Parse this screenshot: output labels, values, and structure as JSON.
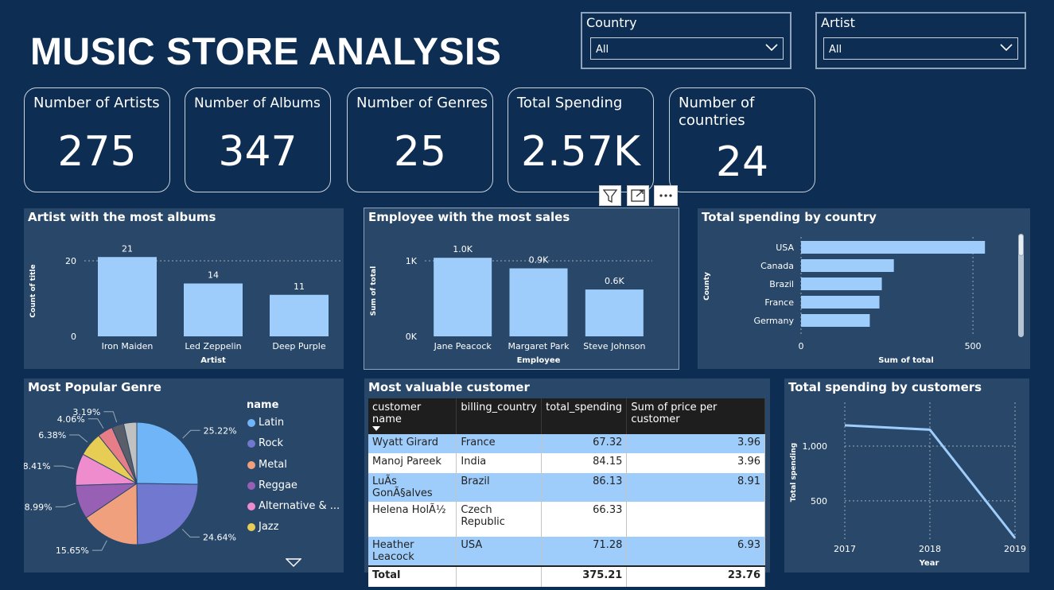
{
  "header": {
    "title": "MUSIC STORE ANALYSIS"
  },
  "slicers": [
    {
      "label": "Country",
      "value": "All"
    },
    {
      "label": "Artist",
      "value": "All"
    }
  ],
  "cards": [
    {
      "label": "Number of Artists",
      "value": "275"
    },
    {
      "label": "Number of Albums",
      "value": "347"
    },
    {
      "label": "Number of Genres",
      "value": "25"
    },
    {
      "label": "Total Spending",
      "value": "2.57K"
    },
    {
      "label_line1": "Number of",
      "label_line2": "countries",
      "value": "24"
    }
  ],
  "visual_header_icons": [
    "filter-icon",
    "focus-mode-icon",
    "more-options-icon"
  ],
  "artist_chart": {
    "title": "Artist with the most albums",
    "chart_data": {
      "type": "bar",
      "categories": [
        "Iron Maiden",
        "Led Zeppelin",
        "Deep Purple"
      ],
      "values": [
        21,
        14,
        11
      ],
      "data_labels": [
        "21",
        "14",
        "11"
      ],
      "xlabel": "Artist",
      "ylabel": "Count of title",
      "yticks": [
        "20",
        "0"
      ],
      "ylim": [
        0,
        24
      ]
    }
  },
  "employee_chart": {
    "title": "Employee with the most sales",
    "chart_data": {
      "type": "bar",
      "categories": [
        "Jane Peacock",
        "Margaret Park",
        "Steve Johnson"
      ],
      "values": [
        1040,
        900,
        620
      ],
      "data_labels": [
        "1.0K",
        "0.9K",
        "0.6K"
      ],
      "xlabel": "Employee",
      "ylabel": "Sum of total",
      "yticks": [
        "1K",
        "0K"
      ],
      "ylim": [
        0,
        1200
      ]
    }
  },
  "country_chart": {
    "title": "Total spending by country",
    "chart_data": {
      "type": "bar",
      "orientation": "horizontal",
      "categories": [
        "USA",
        "Canada",
        "Brazil",
        "France",
        "Germany"
      ],
      "values": [
        535,
        270,
        235,
        228,
        200
      ],
      "xlabel": "Sum of total",
      "ylabel": "County",
      "xticks": [
        "0",
        "500"
      ],
      "xlim": [
        0,
        560
      ]
    }
  },
  "genre_chart": {
    "title": "Most Popular Genre",
    "legend_title": "name",
    "legend": [
      "Latin",
      "Rock",
      "Metal",
      "Reggae",
      "Alternative & ...",
      "Jazz"
    ],
    "chart_data": {
      "type": "pie",
      "slices": [
        {
          "label": "Latin",
          "value": 25.22,
          "text": "25.22%",
          "color": "#6fb5f7"
        },
        {
          "label": "Rock",
          "value": 24.64,
          "text": "24.64%",
          "color": "#7079cf"
        },
        {
          "label": "Metal",
          "value": 15.65,
          "text": "15.65%",
          "color": "#f0a07c"
        },
        {
          "label": "Reggae",
          "value": 8.99,
          "text": "8.99%",
          "color": "#9860b5"
        },
        {
          "label": "Alternative & ...",
          "value": 8.41,
          "text": "8.41%",
          "color": "#ee8ccd"
        },
        {
          "label": "Jazz",
          "value": 6.38,
          "text": "6.38%",
          "color": "#e8cd55"
        },
        {
          "label": "",
          "value": 4.06,
          "text": "4.06%",
          "color": "#e77e87"
        },
        {
          "label": "",
          "value": 3.19,
          "text": "3.19%",
          "color": "#5a5e69"
        },
        {
          "label": "",
          "value": 3.46,
          "text": "",
          "color": "#c1c1c1"
        }
      ]
    }
  },
  "customer_table": {
    "title": "Most valuable customer",
    "columns": [
      "customer name",
      "billing_country",
      "total_spending",
      "Sum of price per customer"
    ],
    "rows": [
      {
        "name": "Wyatt Girard",
        "country": "France",
        "total": "67.32",
        "price": "3.96"
      },
      {
        "name": "Manoj Pareek",
        "country": "India",
        "total": "84.15",
        "price": "3.96"
      },
      {
        "name": "LuÃs GonÃ§alves",
        "country": "Brazil",
        "total": "86.13",
        "price": "8.91"
      },
      {
        "name": "Helena HolÃ½",
        "country": "Czech Republic",
        "total": "66.33",
        "price": ""
      },
      {
        "name": "Heather Leacock",
        "country": "USA",
        "total": "71.28",
        "price": "6.93"
      }
    ],
    "total": {
      "label": "Total",
      "total": "375.21",
      "price": "23.76"
    }
  },
  "customers_line": {
    "title": "Total spending by customers",
    "chart_data": {
      "type": "line",
      "x": [
        "2017",
        "2018",
        "2019"
      ],
      "values": [
        1190,
        1150,
        160
      ],
      "xlabel": "Year",
      "ylabel": "Total spending",
      "yticks": [
        "1,000",
        "500"
      ],
      "ylim": [
        150,
        1400
      ]
    }
  }
}
